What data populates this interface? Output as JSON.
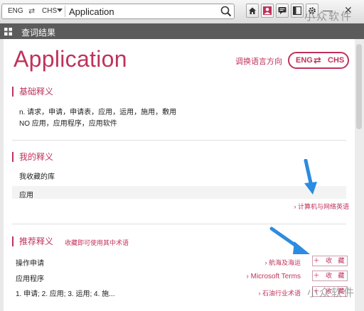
{
  "search": {
    "lang_from": "ENG",
    "lang_swap": "⇄",
    "lang_to": "CHS",
    "query": "Application"
  },
  "panel": {
    "title": "查词结果"
  },
  "entry": {
    "word": "Application",
    "direction_label": "调换语言方向",
    "toggle_from": "ENG",
    "toggle_swap": "⇄",
    "toggle_to": "CHS"
  },
  "basic": {
    "title": "基础释义",
    "lines": [
      "n. 请求，申请，申请表，应用，运用，施用，敷用",
      "NO 应用，应用程序，应用软件"
    ]
  },
  "mine": {
    "title": "我的释义",
    "library_label": "我收藏的库",
    "item": "应用",
    "source_link": "› 计算机与网络英语"
  },
  "recommend": {
    "title": "推荐释义",
    "subtitle": "收藏即可使用其中术语",
    "collect_label": "＋ 收 藏",
    "rows": [
      {
        "term": "操作申请",
        "source": "› 航海及海运"
      },
      {
        "term": "应用程序",
        "source": "› Microsoft Terms"
      },
      {
        "term": "1. 申请; 2. 应用; 3. 运用; 4. 施...",
        "source": "› 石油行业术语"
      }
    ]
  },
  "window": {
    "minimize": "—",
    "close": "✕"
  },
  "watermark": "小众软件",
  "colors": {
    "accent": "#c0325b",
    "arrow": "#2d8be0",
    "strip": "#5b5b5b"
  },
  "icons": [
    "search-icon",
    "home-icon",
    "user-icon",
    "chat-icon",
    "layout-icon",
    "gear-icon",
    "grid-icon"
  ]
}
